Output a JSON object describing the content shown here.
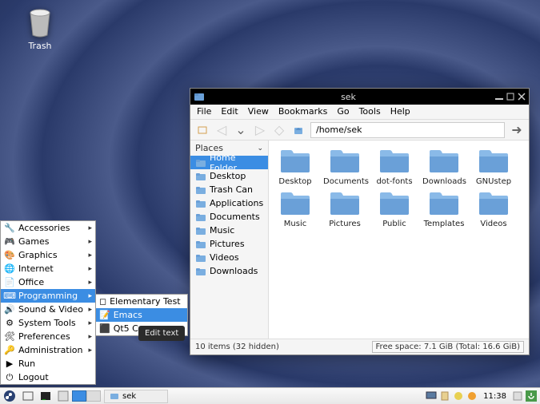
{
  "desktop": {
    "trash_label": "Trash"
  },
  "menu": {
    "categories": [
      "Accessories",
      "Games",
      "Graphics",
      "Internet",
      "Office",
      "Programming",
      "Sound & Video",
      "System Tools",
      "Preferences",
      "Administration",
      "Run",
      "Logout"
    ],
    "active_index": 5,
    "sub": {
      "items": [
        "Elementary Test",
        "Emacs",
        "Qt5 C"
      ],
      "active_index": 1
    },
    "tooltip": "Edit text"
  },
  "fm": {
    "title": "sek",
    "menus": [
      "File",
      "Edit",
      "View",
      "Bookmarks",
      "Go",
      "Tools",
      "Help"
    ],
    "path": "/home/sek",
    "places_header": "Places",
    "places": [
      "Home Folder",
      "Desktop",
      "Trash Can",
      "Applications",
      "Documents",
      "Music",
      "Pictures",
      "Videos",
      "Downloads"
    ],
    "places_selected": 0,
    "folders": [
      "Desktop",
      "Documents",
      "dot-fonts",
      "Downloads",
      "GNUstep",
      "Music",
      "Pictures",
      "Public",
      "Templates",
      "Videos"
    ],
    "status_left": "10 items (32 hidden)",
    "status_right": "Free space: 7.1 GiB (Total: 16.6 GiB)"
  },
  "taskbar": {
    "task_label": "sek",
    "clock": "11:38"
  }
}
